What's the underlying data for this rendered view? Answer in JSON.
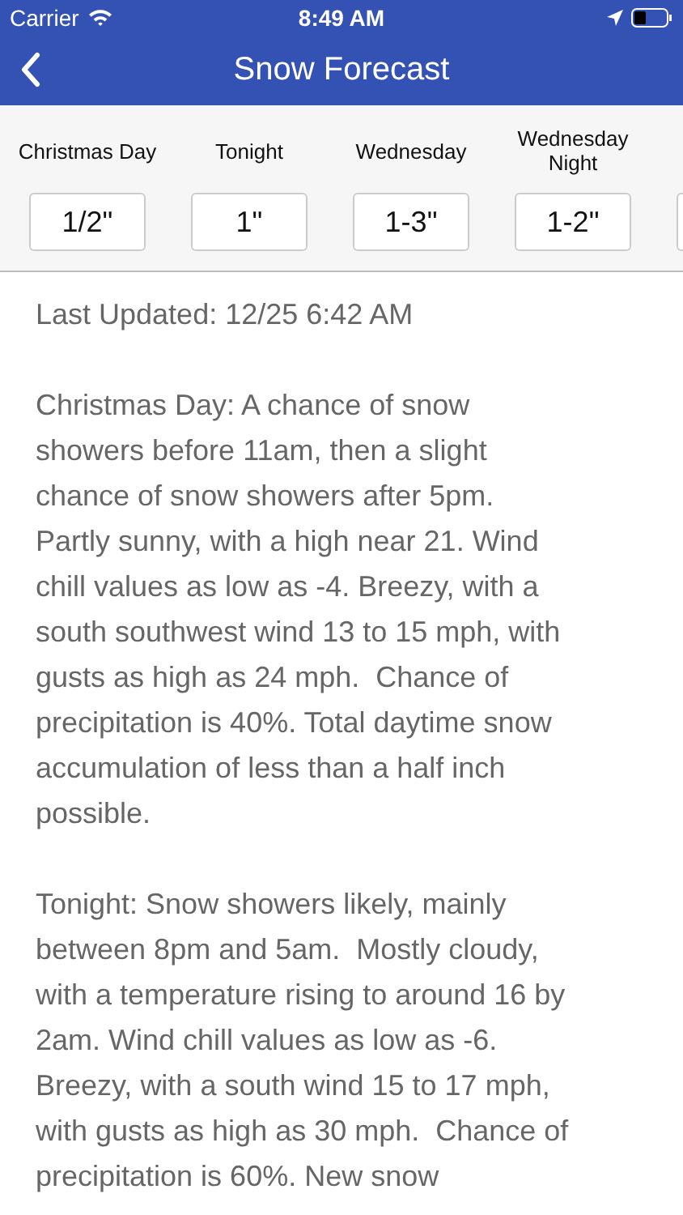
{
  "status_bar": {
    "carrier": "Carrier",
    "time": "8:49 AM"
  },
  "nav_bar": {
    "title": "Snow Forecast"
  },
  "periods": [
    {
      "label": "Christmas Day",
      "amount": "1/2\""
    },
    {
      "label": "Tonight",
      "amount": "1\""
    },
    {
      "label": "Wednesday",
      "amount": "1-3\""
    },
    {
      "label": "Wednesday Night",
      "amount": "1-2\""
    }
  ],
  "last_updated": "Last Updated: 12/25 6:42 AM",
  "paragraphs": [
    [
      "Christmas Day: A chance of snow",
      "showers before 11am, then a slight",
      "chance of snow showers after 5pm.",
      "Partly sunny, with a high near 21. Wind",
      "chill values as low as -4. Breezy, with a",
      "south southwest wind 13 to 15 mph, with",
      "gusts as high as 24 mph.  Chance of",
      "precipitation is 40%. Total daytime snow",
      "accumulation of less than a half inch",
      "possible."
    ],
    [
      "Tonight: Snow showers likely, mainly",
      "between 8pm and 5am.  Mostly cloudy,",
      "with a temperature rising to around 16 by",
      "2am. Wind chill values as low as -6.",
      "Breezy, with a south wind 15 to 17 mph,",
      "with gusts as high as 30 mph.  Chance of",
      "precipitation is 60%. New snow"
    ]
  ]
}
